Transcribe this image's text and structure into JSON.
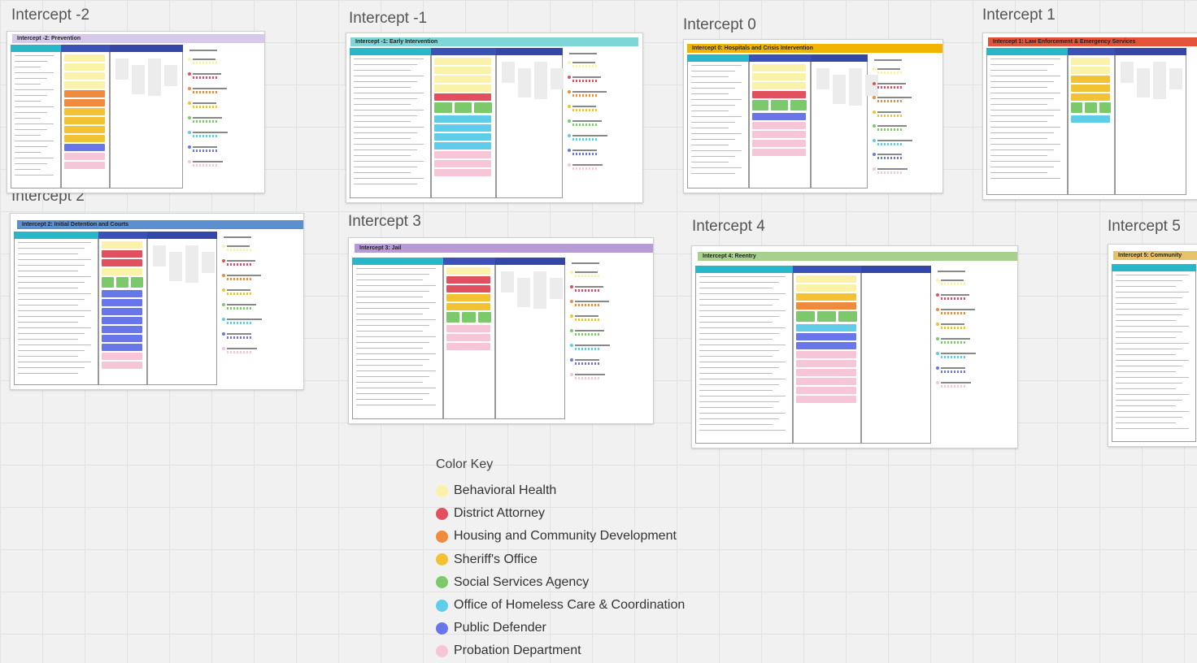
{
  "canvas": {
    "frames": [
      {
        "id": "ineg2",
        "label": "Intercept -2",
        "board_title": "Intercept -2: Prevention",
        "title_color": "#d7c9ea"
      },
      {
        "id": "ineg1",
        "label": "Intercept -1",
        "board_title": "Intercept -1: Early Intervention",
        "title_color": "#7fd6d6"
      },
      {
        "id": "i0",
        "label": "Intercept 0",
        "board_title": "Intercept 0: Hospitals and Crisis Intervention",
        "title_color": "#f0b400"
      },
      {
        "id": "i1",
        "label": "Intercept 1",
        "board_title": "Intercept 1: Law Enforcement & Emergency Services",
        "title_color": "#e2533a"
      },
      {
        "id": "i2",
        "label": "Intercept 2",
        "board_title": "Intercept 2: Initial Detention and Courts",
        "title_color": "#5b8fcf"
      },
      {
        "id": "i3",
        "label": "Intercept 3",
        "board_title": "Intercept 3: Jail",
        "title_color": "#b79ad6"
      },
      {
        "id": "i4",
        "label": "Intercept 4",
        "board_title": "Intercept 4: Reentry",
        "title_color": "#a8cf8e"
      },
      {
        "id": "i5",
        "label": "Intercept 5",
        "board_title": "Intercept 5: Community",
        "title_color": "#e6c36a"
      }
    ]
  },
  "color_key": {
    "title": "Color Key",
    "items": [
      {
        "label": "Behavioral Health",
        "color": "#fbf2a9"
      },
      {
        "label": "District Attorney",
        "color": "#e0505e"
      },
      {
        "label": "Housing and Community Development",
        "color": "#f08a3c"
      },
      {
        "label": "Sheriff's Office",
        "color": "#f2c232"
      },
      {
        "label": "Social Services Agency",
        "color": "#7cc96c"
      },
      {
        "label": "Office of Homeless Care & Coordination",
        "color": "#5fcdea"
      },
      {
        "label": "Public Defender",
        "color": "#6876ea"
      },
      {
        "label": "Probation Department",
        "color": "#f6c6d8"
      }
    ]
  },
  "colors": {
    "header_teal": "#27b7c9",
    "header_blue": "#3a52b8",
    "header_navy": "#3446a8"
  }
}
